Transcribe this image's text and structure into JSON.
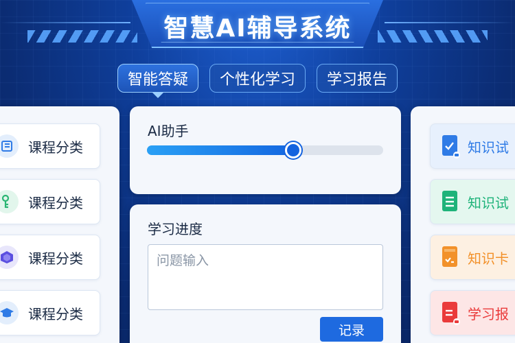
{
  "header": {
    "title": "智慧AI辅导系统"
  },
  "tabs": [
    {
      "label": "智能答疑",
      "active": true
    },
    {
      "label": "个性化学习",
      "active": false
    },
    {
      "label": "学习报告",
      "active": false
    }
  ],
  "left_sidebar": {
    "items": [
      {
        "label": "课程分类",
        "icon": "book-icon",
        "color": "#2f7be6"
      },
      {
        "label": "课程分类",
        "icon": "key-icon",
        "color": "#2bb673"
      },
      {
        "label": "课程分类",
        "icon": "cube-icon",
        "color": "#5b4fe0"
      },
      {
        "label": "课程分类",
        "icon": "graduation-cap-icon",
        "color": "#2f7be6"
      }
    ]
  },
  "ai_card": {
    "title": "AI助手",
    "slider_value": 0.62
  },
  "progress_card": {
    "title": "学习进度",
    "input_placeholder": "问题输入",
    "input_value": "",
    "record_button": "记录"
  },
  "right_sidebar": {
    "items": [
      {
        "label": "知识试",
        "icon": "blue-document-icon",
        "color": "#2f7be6",
        "bg": "#e7f0fd"
      },
      {
        "label": "知识试",
        "icon": "green-document-icon",
        "color": "#1fb37a",
        "bg": "#e4f7ef"
      },
      {
        "label": "知识卡",
        "icon": "orange-document-icon",
        "color": "#f2912a",
        "bg": "#fdf0e2"
      },
      {
        "label": "学习报",
        "icon": "red-document-icon",
        "color": "#ea3b3b",
        "bg": "#fde6e6"
      }
    ]
  }
}
